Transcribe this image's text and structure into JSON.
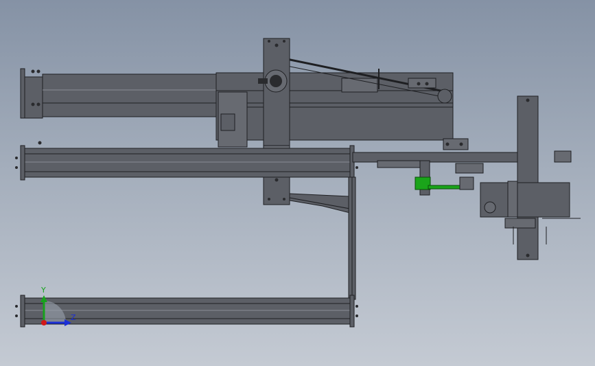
{
  "triad": {
    "y_label": "Y",
    "z_label": "Z",
    "colors": {
      "y": "#16a31c",
      "z": "#1b2fd6",
      "x": "#d11818"
    }
  },
  "colors": {
    "background_top": "#8592a5",
    "background_bottom": "#c4cad3",
    "steel": "#5c5f66",
    "edge": "#1e1f22",
    "highlight_part": "#1aa41a"
  }
}
